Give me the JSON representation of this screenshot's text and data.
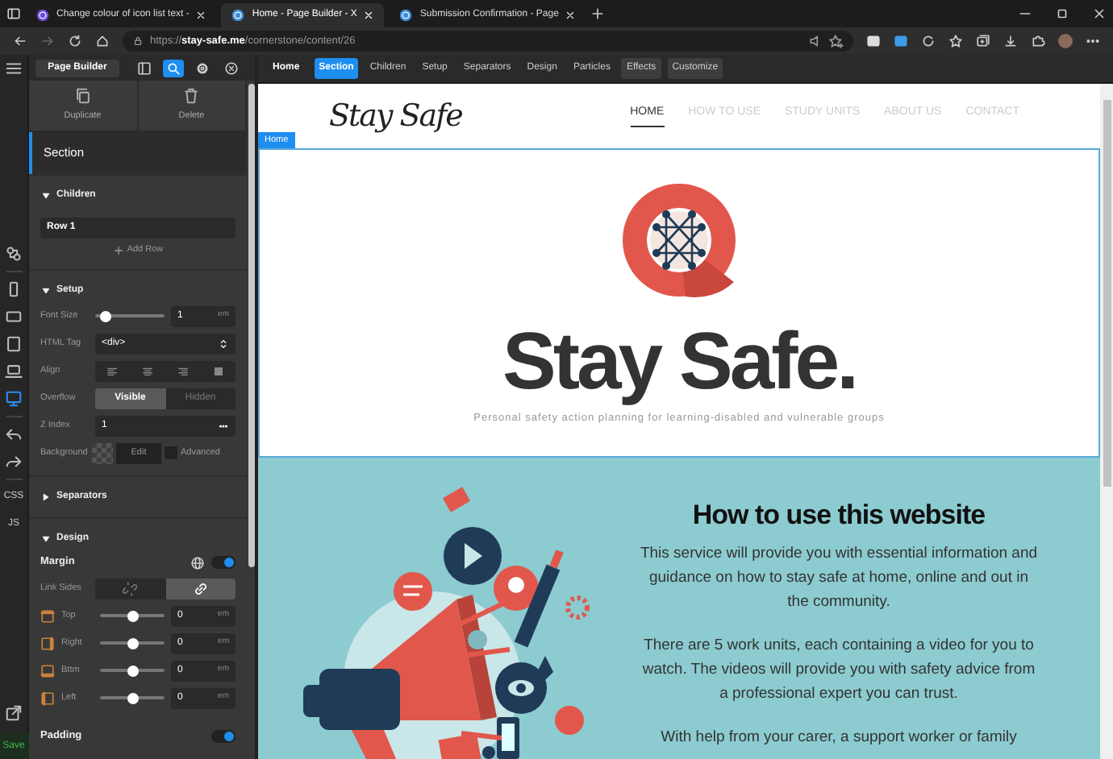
{
  "browser": {
    "tabs": [
      {
        "title": "Change colour of icon list text -",
        "kind": "forum",
        "selected": false
      },
      {
        "title": "Home - Page Builder - X",
        "kind": "wordpress",
        "selected": true
      },
      {
        "title": "Submission Confirmation - Page",
        "kind": "wordpress",
        "selected": false
      }
    ],
    "url": "https://**stay-safe.me**/cornerstone/content/26"
  },
  "rail": {
    "devices": [
      {
        "kind": "phone",
        "selected": false
      },
      {
        "kind": "tablet-landscape",
        "selected": false
      },
      {
        "kind": "tablet",
        "selected": false
      },
      {
        "kind": "laptop",
        "selected": false
      },
      {
        "kind": "desktop",
        "selected": true
      }
    ],
    "code_buttons": [
      "CSS",
      "JS"
    ],
    "save_label": "Save"
  },
  "builder": {
    "title": "Page Builder",
    "tools": [
      {
        "kind": "layout",
        "selected": false
      },
      {
        "kind": "search",
        "selected": true
      },
      {
        "kind": "settings",
        "selected": false
      },
      {
        "kind": "close",
        "selected": false
      }
    ],
    "breadcrumb": "Home",
    "tabs": [
      {
        "label": "Section",
        "kind": "tab",
        "selected": true
      },
      {
        "label": "Children",
        "kind": "tab",
        "selected": false
      },
      {
        "label": "Setup",
        "kind": "tab",
        "selected": false
      },
      {
        "label": "Separators",
        "kind": "tab",
        "selected": false
      },
      {
        "label": "Design",
        "kind": "tab",
        "selected": false
      },
      {
        "label": "Particles",
        "kind": "tab",
        "selected": false
      },
      {
        "label": "Effects",
        "kind": "button",
        "selected": false
      },
      {
        "label": "Customize",
        "kind": "button",
        "selected": false
      }
    ]
  },
  "panel": {
    "actions": [
      {
        "kind": "duplicate",
        "label": "Duplicate"
      },
      {
        "kind": "delete",
        "label": "Delete"
      }
    ],
    "heading": "Section",
    "groups": [
      {
        "title": "Children",
        "expanded": true,
        "controls": [
          {
            "kind": "row-item",
            "value": "Row 1"
          },
          {
            "kind": "add",
            "label": "Add Row"
          }
        ]
      },
      {
        "title": "Setup",
        "expanded": true,
        "controls": [
          {
            "kind": "slider",
            "label": "Font Size",
            "level": 0.15,
            "value": "1",
            "unit": "em"
          },
          {
            "kind": "select",
            "label": "HTML Tag",
            "value": "<div>"
          },
          {
            "kind": "align",
            "label": "Align"
          },
          {
            "kind": "segmented",
            "label": "Overflow",
            "options": [
              {
                "label": "Visible",
                "selected": true
              },
              {
                "label": "Hidden",
                "selected": false
              }
            ]
          },
          {
            "kind": "input",
            "label": "Z Index",
            "value": "1"
          },
          {
            "kind": "background",
            "label": "Background",
            "button": "Edit",
            "checkbox_label": "Advanced",
            "checked": false
          }
        ]
      },
      {
        "title": "Separators",
        "expanded": false
      },
      {
        "title": "Design",
        "expanded": true,
        "controls": [
          {
            "kind": "toggle-heading",
            "label": "Margin",
            "responsive": true,
            "on": true
          },
          {
            "kind": "link-sides",
            "label": "Link Sides",
            "options": [
              {
                "kind": "unlink",
                "selected": false
              },
              {
                "kind": "link",
                "selected": true
              }
            ]
          },
          {
            "kind": "side-top",
            "label": "Top",
            "level": 0.5,
            "value": "0",
            "unit": "em"
          },
          {
            "kind": "side-right",
            "label": "Right",
            "level": 0.5,
            "value": "0",
            "unit": "em"
          },
          {
            "kind": "side-bottom",
            "label": "Bttm",
            "level": 0.5,
            "value": "0",
            "unit": "em"
          },
          {
            "kind": "side-left",
            "label": "Left",
            "level": 0.5,
            "value": "0",
            "unit": "em"
          },
          {
            "kind": "toggle-heading",
            "label": "Padding",
            "on": true
          }
        ]
      }
    ]
  },
  "site": {
    "logo": "Stay Safe",
    "nav": [
      {
        "label": "HOME",
        "selected": true
      },
      {
        "label": "HOW TO USE",
        "selected": false
      },
      {
        "label": "STUDY UNITS",
        "selected": false
      },
      {
        "label": "ABOUT US",
        "selected": false
      },
      {
        "label": "CONTACT",
        "selected": false
      }
    ],
    "page_tag": "Home",
    "hero": {
      "title": "Stay Safe.",
      "subtitle": "Personal safety action planning for learning-disabled and vulnerable groups"
    },
    "intro": {
      "heading": "How to use this website",
      "paragraphs": [
        "This service will provide you with essential information and guidance on how to stay safe at home, online and out in the community.",
        "There are 5 work units, each containing a video for you to watch.  The videos will provide you with safety advice from a professional expert you can trust.",
        "With help from your carer, a support worker or family"
      ]
    }
  }
}
